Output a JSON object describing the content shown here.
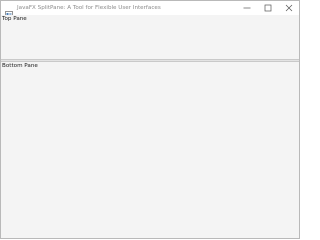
{
  "window": {
    "title": "JavaFX SplitPane: A Tool for Flexible User Interfaces",
    "icon": "java-app-icon",
    "controls": {
      "minimize": "minimize-icon",
      "maximize": "maximize-icon",
      "close": "close-icon"
    }
  },
  "split_pane": {
    "orientation": "vertical",
    "top_pane": {
      "label": "Top Pane"
    },
    "bottom_pane": {
      "label": "Bottom Pane"
    }
  }
}
